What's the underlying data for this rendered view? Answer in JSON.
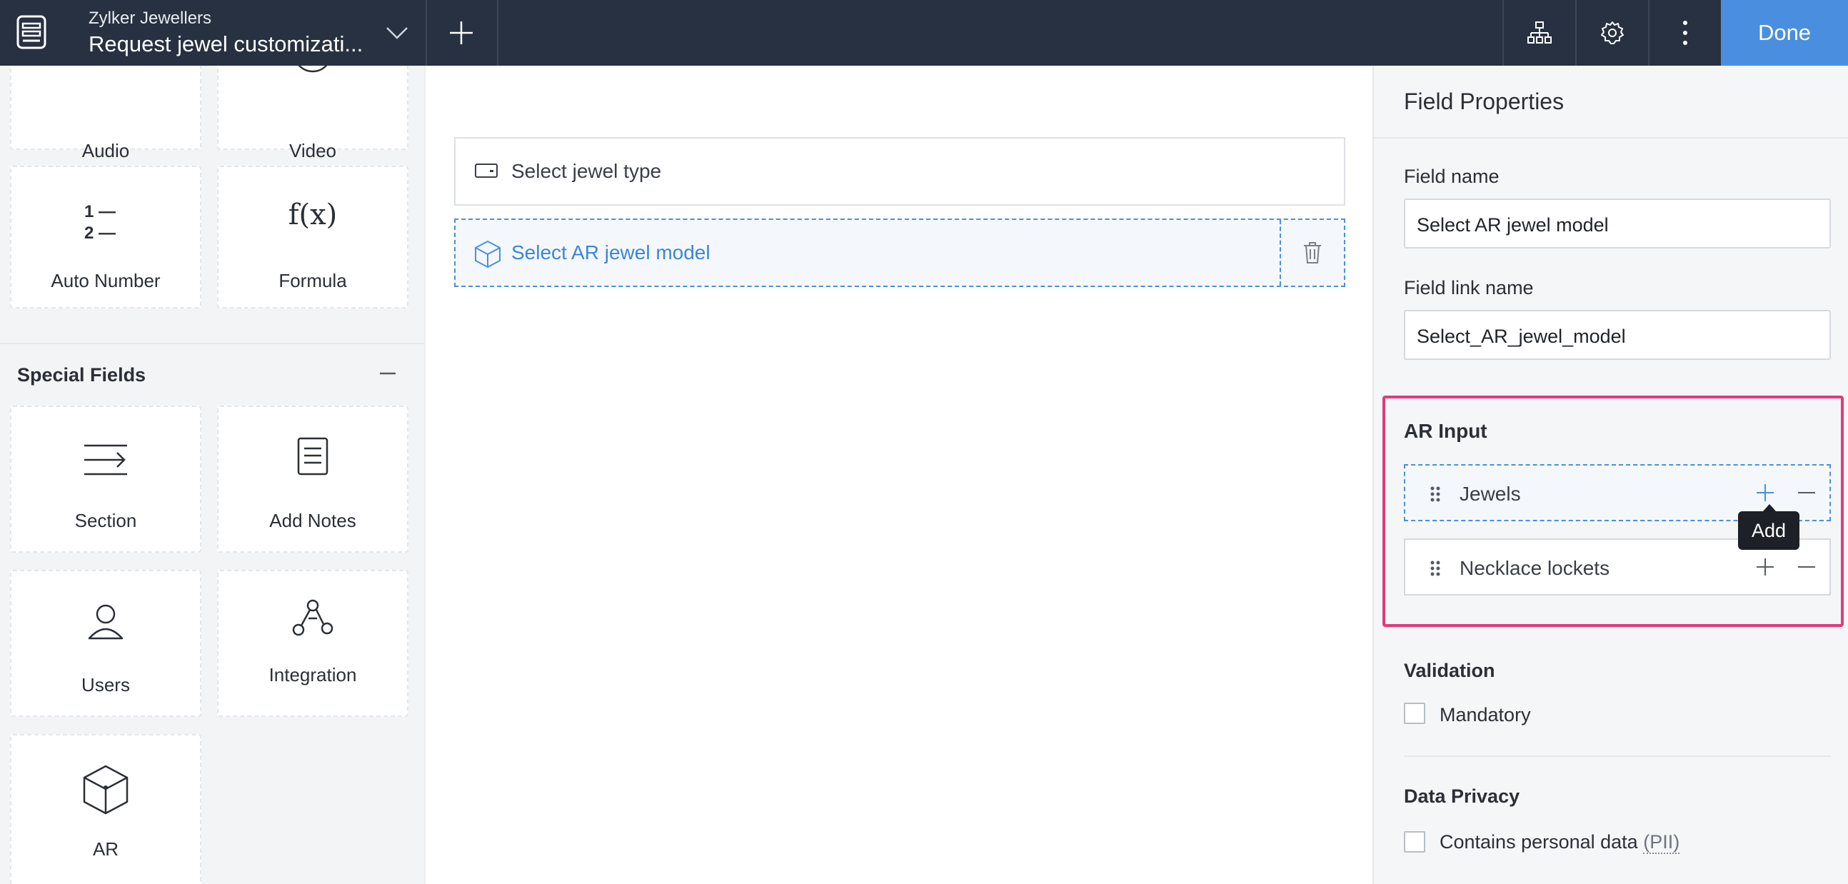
{
  "header": {
    "subtitle": "Zylker Jewellers",
    "title": "Request jewel customizati...",
    "done_label": "Done"
  },
  "palette": {
    "top_tiles": [
      {
        "label": "Audio",
        "icon": "audio-icon"
      },
      {
        "label": "Video",
        "icon": "video-icon"
      },
      {
        "label": "Auto Number",
        "icon": "auto-number-icon"
      },
      {
        "label": "Formula",
        "icon": "formula-icon"
      }
    ],
    "formula_glyph": "f(x)",
    "auto_number_glyph": [
      "1 —",
      "2 —"
    ],
    "special_section_title": "Special Fields",
    "special_tiles": [
      {
        "label": "Section",
        "icon": "section-icon"
      },
      {
        "label": "Add Notes",
        "icon": "notes-icon"
      },
      {
        "label": "Users",
        "icon": "users-icon"
      },
      {
        "label": "Integration",
        "icon": "integration-icon"
      },
      {
        "label": "AR",
        "icon": "ar-cube-icon"
      }
    ]
  },
  "canvas": {
    "fields": [
      {
        "label": "Select jewel type",
        "icon": "dropdown-field-icon",
        "selected": false
      },
      {
        "label": "Select AR jewel model",
        "icon": "ar-cube-icon",
        "selected": true
      }
    ]
  },
  "properties": {
    "title": "Field Properties",
    "field_name_label": "Field name",
    "field_name_value": "Select AR jewel model",
    "link_name_label": "Field link name",
    "link_name_value": "Select_AR_jewel_model",
    "ar_input_title": "AR Input",
    "ar_items": [
      "Jewels",
      "Necklace lockets"
    ],
    "tooltip": "Add",
    "validation_title": "Validation",
    "mandatory_label": "Mandatory",
    "privacy_title": "Data Privacy",
    "privacy_label": "Contains personal data",
    "privacy_pii": "(PII)"
  },
  "colors": {
    "topbar": "#283142",
    "accent": "#4a8fdf",
    "highlight": "#e23a7b"
  }
}
